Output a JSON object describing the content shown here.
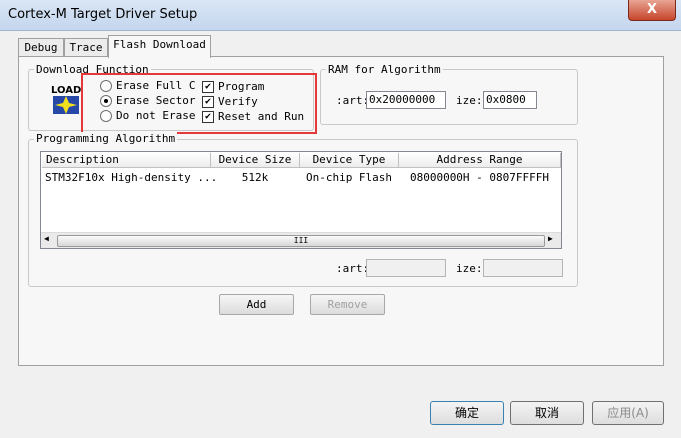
{
  "window": {
    "title": "Cortex-M Target Driver Setup",
    "close_label": "X"
  },
  "tabs": [
    {
      "label": "Debug"
    },
    {
      "label": "Trace"
    },
    {
      "label": "Flash Download"
    }
  ],
  "download_function": {
    "group_label": "Download Function",
    "icon_text": "LOAD",
    "radios": [
      {
        "label": "Erase Full C",
        "selected": false
      },
      {
        "label": "Erase Sector",
        "selected": true
      },
      {
        "label": "Do not Erase",
        "selected": false
      }
    ],
    "checks": [
      {
        "label": "Program",
        "checked": true,
        "mark": "✔"
      },
      {
        "label": "Verify",
        "checked": true,
        "mark": "✔"
      },
      {
        "label": "Reset and Run",
        "checked": true,
        "mark": "✔"
      }
    ]
  },
  "ram": {
    "group_label": "RAM for Algorithm",
    "start_label": ":art:",
    "start_value": "0x20000000",
    "size_label": "ize:",
    "size_value": "0x0800"
  },
  "programming": {
    "group_label": "Programming Algorithm",
    "columns": [
      "Description",
      "Device Size",
      "Device Type",
      "Address Range"
    ],
    "rows": [
      [
        "STM32F10x High-density ...",
        "512k",
        "On-chip Flash",
        "08000000H - 0807FFFFH"
      ]
    ],
    "scroll_left": "◀",
    "scroll_right": "▶",
    "scroll_grip": "III",
    "start_label": ":art:",
    "size_label": "ize:",
    "add_label": "Add",
    "remove_label": "Remove"
  },
  "dialog_buttons": {
    "ok": "确定",
    "cancel": "取消",
    "apply": "应用(A)"
  }
}
